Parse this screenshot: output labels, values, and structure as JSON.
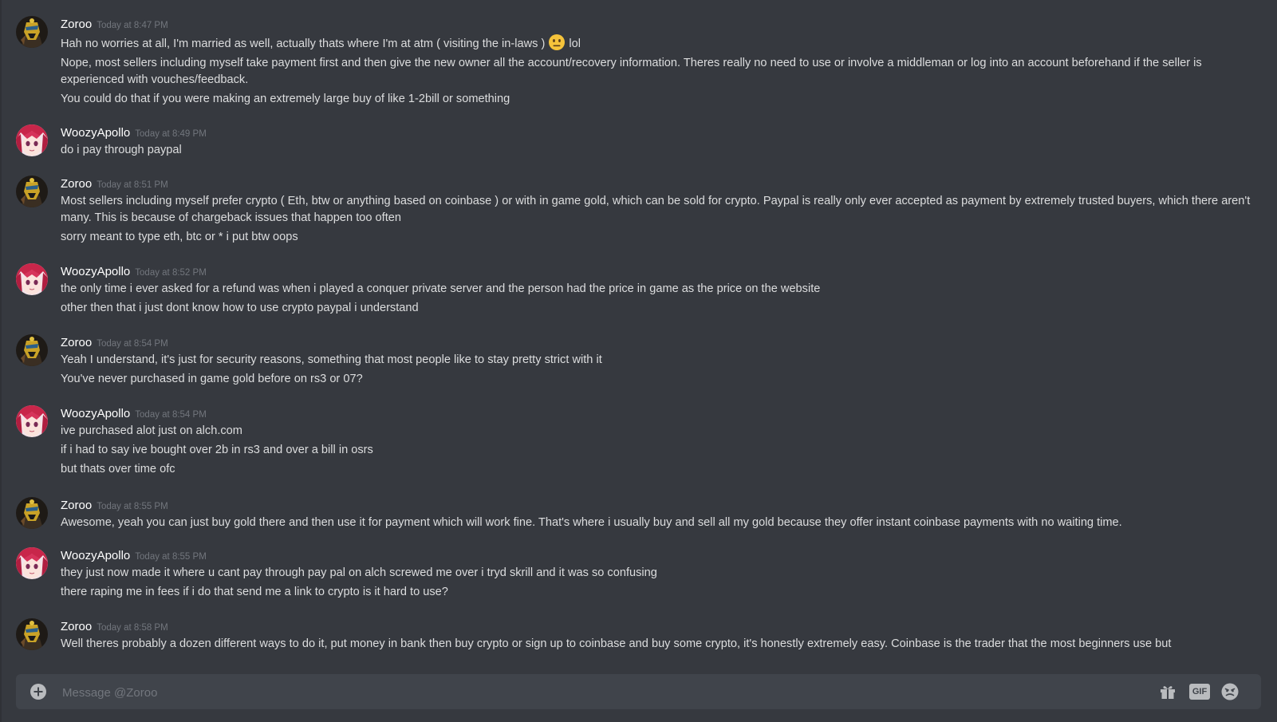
{
  "users": {
    "zoroo": "Zoroo",
    "woozy": "WoozyApollo"
  },
  "messages": [
    {
      "author": "Zoroo",
      "time": "Today at 8:47 PM",
      "lines": [
        "Hah no worries at all, I'm married as well, actually thats where I'm at atm ( visiting the in-laws )",
        "lol",
        "Nope, most sellers including myself take payment first and then give the new owner all the account/recovery information. Theres really no need to use or involve a middleman or log into an account beforehand if the seller is experienced with vouches/feedback.",
        "You could do that if you were making an extremely large buy of like 1-2bill or something"
      ]
    },
    {
      "author": "WoozyApollo",
      "time": "Today at 8:49 PM",
      "lines": [
        "do i pay through paypal"
      ]
    },
    {
      "author": "Zoroo",
      "time": "Today at 8:51 PM",
      "lines": [
        "Most sellers including myself prefer crypto ( Eth, btw or anything based on coinbase ) or with in game gold, which can be sold for crypto. Paypal is really only ever accepted as payment by extremely trusted buyers, which there aren't many. This is because of chargeback issues that happen too often",
        "sorry meant to type eth, btc or * i put btw oops"
      ]
    },
    {
      "author": "WoozyApollo",
      "time": "Today at 8:52 PM",
      "lines": [
        "the only time i ever asked for a refund was when i played a conquer private server and the person had the price in game as the price on the website",
        "other then that i just dont know how to use crypto paypal i understand"
      ]
    },
    {
      "author": "Zoroo",
      "time": "Today at 8:54 PM",
      "lines": [
        "Yeah I understand, it's just for security reasons, something that most people like to stay pretty strict with it",
        "You've never purchased in game gold before on rs3 or 07?"
      ]
    },
    {
      "author": "WoozyApollo",
      "time": "Today at 8:54 PM",
      "lines": [
        "ive purchased alot just on alch.com",
        "if i had to say ive bought over 2b in rs3 and over a bill in osrs",
        "but thats over time ofc"
      ]
    },
    {
      "author": "Zoroo",
      "time": "Today at 8:55 PM",
      "lines": [
        "Awesome, yeah you can just buy gold there and then use it for payment which will work fine. That's where i usually buy and sell all my gold because they offer instant coinbase payments with no waiting time."
      ]
    },
    {
      "author": "WoozyApollo",
      "time": "Today at 8:55 PM",
      "lines": [
        "they just now made it where u cant pay through pay pal on alch screwed me over i tryd skrill and it was so confusing",
        "there raping me in fees if i do that send me a link to crypto is it hard to use?"
      ]
    },
    {
      "author": "Zoroo",
      "time": "Today at 8:58 PM",
      "lines": [
        "Well theres probably a dozen different ways to do it, put money in bank then buy crypto or sign up to coinbase and buy some crypto, it's honestly extremely easy. Coinbase is the trader that the most beginners use but"
      ]
    }
  ],
  "composer": {
    "placeholder": "Message @Zoroo",
    "gif_label": "GIF"
  },
  "icons": {
    "add": "plus-circle-icon",
    "gift": "gift-icon",
    "gif": "gif-icon",
    "emoji": "emoji-icon",
    "inline_emoji": "neutral-face-emoji"
  },
  "colors": {
    "background": "#36393f",
    "composer": "#40444b",
    "username": "#ffffff",
    "timestamp": "#72767d",
    "text": "#dcddde"
  }
}
